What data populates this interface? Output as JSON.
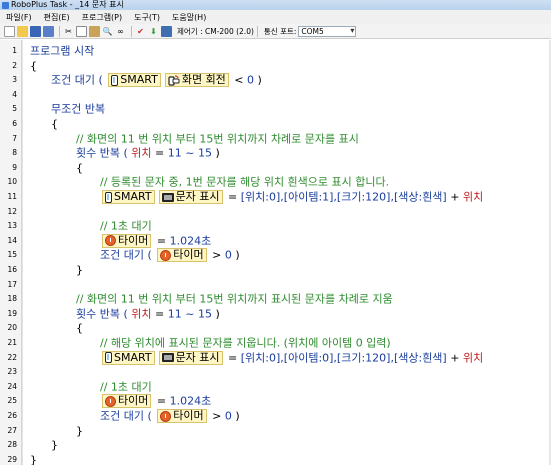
{
  "window": {
    "title": "RoboPlus Task - _14 문자 표시"
  },
  "menu": [
    "파일(F)",
    "편집(E)",
    "프로그램(P)",
    "도구(T)",
    "도움말(H)"
  ],
  "toolbar": {
    "controller_label": "제어기 : CM-200 (2.0)",
    "port_label": "통신 포트:",
    "port_value": "COM5"
  },
  "lines": [
    {
      "n": "1",
      "segments": [
        {
          "c": "kw",
          "t": "프로그램 시작"
        }
      ]
    },
    {
      "n": "2",
      "segments": [
        {
          "c": "plain",
          "t": "{"
        }
      ]
    },
    {
      "n": "3",
      "segments": [
        {
          "c": "kw",
          "t": "조건 대기 ( "
        },
        {
          "chip": "phone",
          "t": "SMART"
        },
        {
          "chip": "rotate",
          "t": "화면 회전"
        },
        {
          "c": "plain",
          "t": " < "
        },
        {
          "c": "num",
          "t": "0"
        },
        {
          "c": "plain",
          "t": " )"
        }
      ]
    },
    {
      "n": "4",
      "segments": []
    },
    {
      "n": "5",
      "segments": [
        {
          "c": "kw",
          "t": "무조건 반복"
        }
      ]
    },
    {
      "n": "6",
      "segments": [
        {
          "c": "plain",
          "t": "{"
        }
      ]
    },
    {
      "n": "7",
      "segments": [
        {
          "c": "cmt",
          "t": "// 화면의 11 번 위치 부터 15번 위치까지 차례로 문자를 표시"
        }
      ]
    },
    {
      "n": "8",
      "segments": [
        {
          "c": "kw",
          "t": "횟수 반복 ( "
        },
        {
          "c": "red",
          "t": "위치"
        },
        {
          "c": "plain",
          "t": " = "
        },
        {
          "c": "num",
          "t": "11 ~ 15"
        },
        {
          "c": "plain",
          "t": " )"
        }
      ]
    },
    {
      "n": "9",
      "segments": [
        {
          "c": "plain",
          "t": "{"
        }
      ]
    },
    {
      "n": "10",
      "segments": [
        {
          "c": "cmt",
          "t": "// 등록된 문자 중, 1번 문자를 해당 위치 흰색으로 표시 합니다."
        }
      ]
    },
    {
      "n": "11",
      "segments": [
        {
          "chip": "phone",
          "t": "SMART"
        },
        {
          "chip": "display",
          "t": "문자 표시"
        },
        {
          "c": "plain",
          "t": " = "
        },
        {
          "c": "param",
          "t": "[위치:0],[아이템:1],[크기:120],[색상:흰색]"
        },
        {
          "c": "plain",
          "t": "   +  "
        },
        {
          "c": "red",
          "t": "위치"
        }
      ]
    },
    {
      "n": "12",
      "segments": []
    },
    {
      "n": "13",
      "segments": [
        {
          "c": "cmt",
          "t": "// 1초 대기"
        }
      ]
    },
    {
      "n": "14",
      "segments": [
        {
          "chip": "timer",
          "t": "타이머"
        },
        {
          "c": "plain",
          "t": " = "
        },
        {
          "c": "num",
          "t": "1.024초"
        }
      ]
    },
    {
      "n": "15",
      "segments": [
        {
          "c": "kw",
          "t": "조건 대기 ( "
        },
        {
          "chip": "timer",
          "t": "타이머"
        },
        {
          "c": "plain",
          "t": " > "
        },
        {
          "c": "num",
          "t": "0"
        },
        {
          "c": "plain",
          "t": " )"
        }
      ]
    },
    {
      "n": "16",
      "segments": [
        {
          "c": "plain",
          "t": "}"
        }
      ]
    },
    {
      "n": "17",
      "segments": []
    },
    {
      "n": "18",
      "segments": [
        {
          "c": "cmt",
          "t": "// 화면의 11 번 위치 부터 15번 위치까지 표시된 문자를 차례로 지움"
        }
      ]
    },
    {
      "n": "19",
      "segments": [
        {
          "c": "kw",
          "t": "횟수 반복 ( "
        },
        {
          "c": "red",
          "t": "위치"
        },
        {
          "c": "plain",
          "t": " = "
        },
        {
          "c": "num",
          "t": "11 ~ 15"
        },
        {
          "c": "plain",
          "t": " )"
        }
      ]
    },
    {
      "n": "20",
      "segments": [
        {
          "c": "plain",
          "t": "{"
        }
      ]
    },
    {
      "n": "21",
      "segments": [
        {
          "c": "cmt",
          "t": "// 해당 위치에 표시된 문자를 지웁니다. (위치에 아이템 0 입력)"
        }
      ]
    },
    {
      "n": "22",
      "segments": [
        {
          "chip": "phone",
          "t": "SMART"
        },
        {
          "chip": "display",
          "t": "문자 표시"
        },
        {
          "c": "plain",
          "t": " = "
        },
        {
          "c": "param",
          "t": "[위치:0],[아이템:0],[크기:120],[색상:흰색]"
        },
        {
          "c": "plain",
          "t": "   +  "
        },
        {
          "c": "red",
          "t": "위치"
        }
      ]
    },
    {
      "n": "23",
      "segments": []
    },
    {
      "n": "24",
      "segments": [
        {
          "c": "cmt",
          "t": "// 1초 대기"
        }
      ]
    },
    {
      "n": "25",
      "segments": [
        {
          "chip": "timer",
          "t": "타이머"
        },
        {
          "c": "plain",
          "t": " = "
        },
        {
          "c": "num",
          "t": "1.024초"
        }
      ]
    },
    {
      "n": "26",
      "segments": [
        {
          "c": "kw",
          "t": "조건 대기 ( "
        },
        {
          "chip": "timer",
          "t": "타이머"
        },
        {
          "c": "plain",
          "t": " > "
        },
        {
          "c": "num",
          "t": "0"
        },
        {
          "c": "plain",
          "t": " )"
        }
      ]
    },
    {
      "n": "27",
      "segments": [
        {
          "c": "plain",
          "t": "}"
        }
      ]
    },
    {
      "n": "28",
      "segments": [
        {
          "c": "plain",
          "t": "}"
        }
      ]
    },
    {
      "n": "29",
      "segments": [
        {
          "c": "plain",
          "t": "}"
        }
      ]
    }
  ]
}
